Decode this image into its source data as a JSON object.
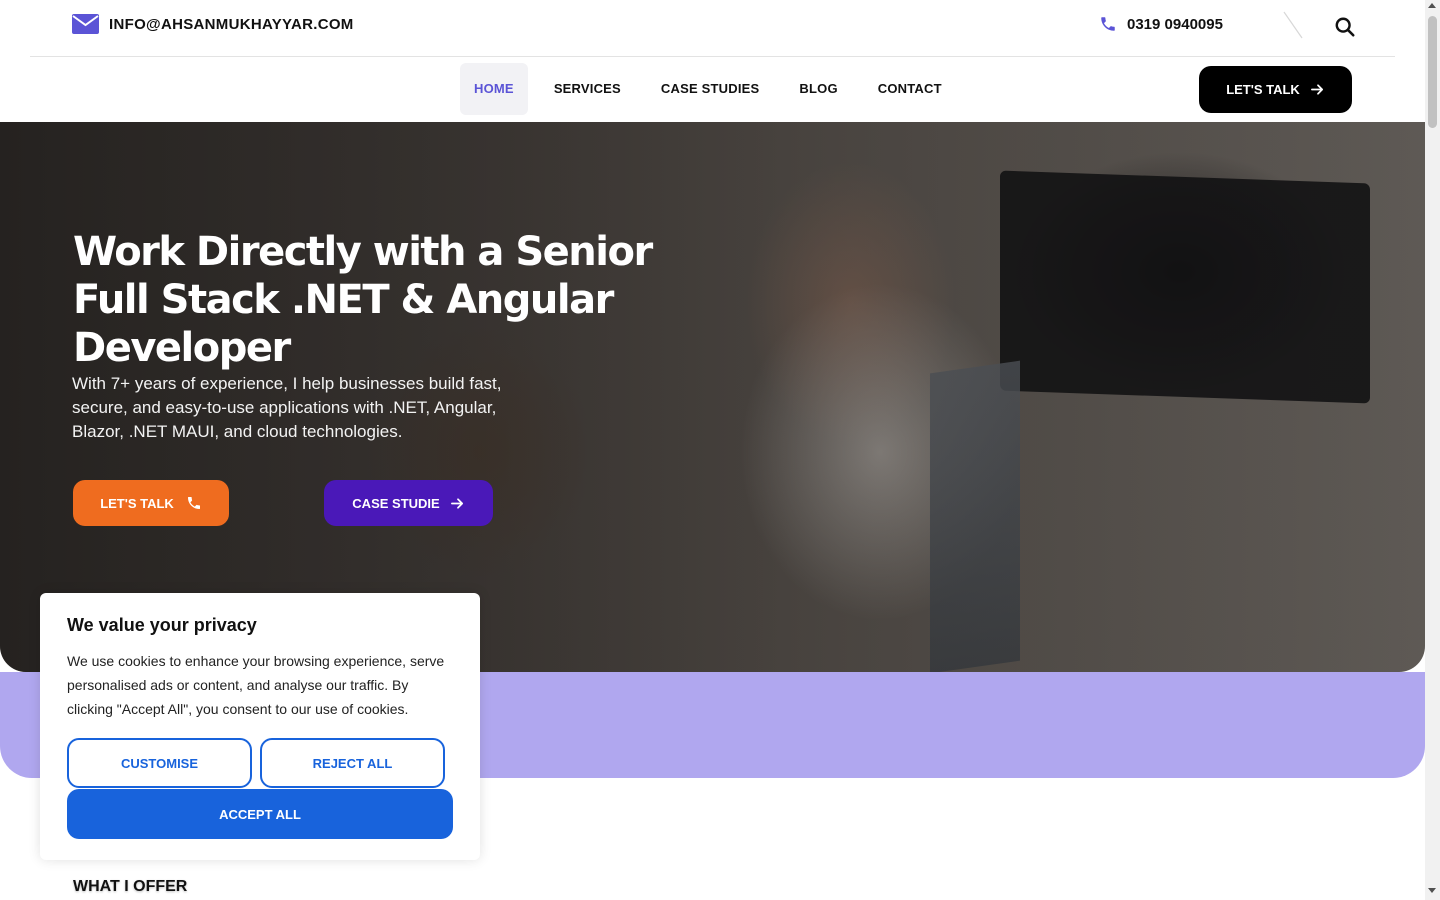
{
  "topbar": {
    "email": "INFO@AHSANMUKHAYYAR.COM",
    "phone": "0319 0940095",
    "icons": {
      "email": "mail-icon",
      "phone": "phone-icon",
      "search": "search-icon"
    }
  },
  "nav": {
    "links": [
      {
        "label": "HOME",
        "active": true
      },
      {
        "label": "SERVICES",
        "active": false
      },
      {
        "label": "CASE STUDIES",
        "active": false
      },
      {
        "label": "BLOG",
        "active": false
      },
      {
        "label": "CONTACT",
        "active": false
      }
    ],
    "cta_label": "LET'S TALK"
  },
  "hero": {
    "title": "Work Directly with a Senior Full Stack .NET & Angular Developer",
    "subtitle": "With 7+ years of experience, I help businesses build fast, secure, and easy-to-use applications with .NET, Angular, Blazor, .NET MAUI, and cloud technologies.",
    "primary_button": "LET'S TALK",
    "secondary_button": "CASE STUDIE"
  },
  "section": {
    "label": "WHAT I OFFER"
  },
  "cookie": {
    "title": "We value your privacy",
    "text": "We use cookies to enhance your browsing experience, serve personalised ads or content, and analyse our traffic. By clicking \"Accept All\", you consent to our use of cookies.",
    "customise": "CUSTOMISE",
    "reject": "REJECT ALL",
    "accept": "ACCEPT ALL"
  },
  "colors": {
    "accent_purple": "#5b54d6",
    "orange": "#ef6c1f",
    "deep_purple": "#4a18b8",
    "band": "#b0a7ef",
    "cookie_blue": "#1863dc"
  }
}
